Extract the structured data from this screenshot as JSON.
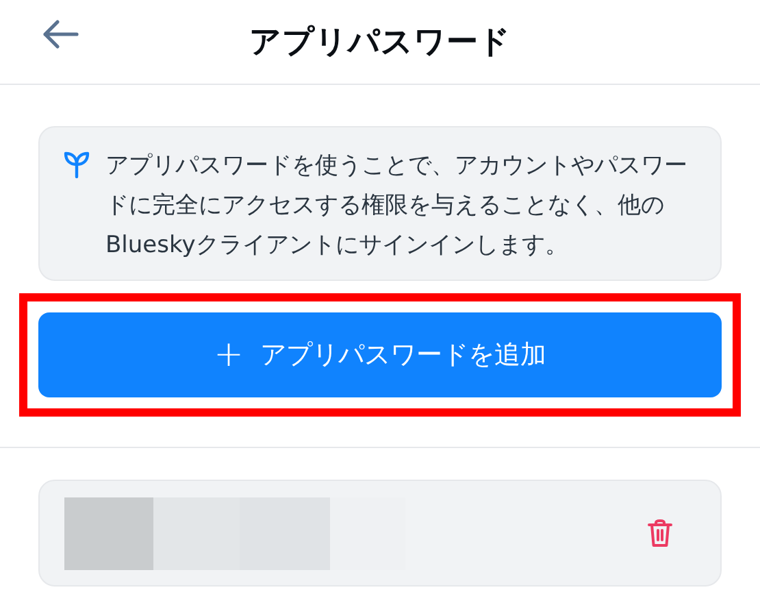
{
  "header": {
    "title": "アプリパスワード"
  },
  "info": {
    "text": "アプリパスワードを使うことで、アカウントやパスワードに完全にアクセスする権限を与えることなく、他のBlueskyクライアントにサインインします。"
  },
  "add_button": {
    "icon": "+",
    "label": "アプリパスワードを追加",
    "highlighted": true
  },
  "app_passwords": [
    {
      "kind": "redacted"
    }
  ]
}
